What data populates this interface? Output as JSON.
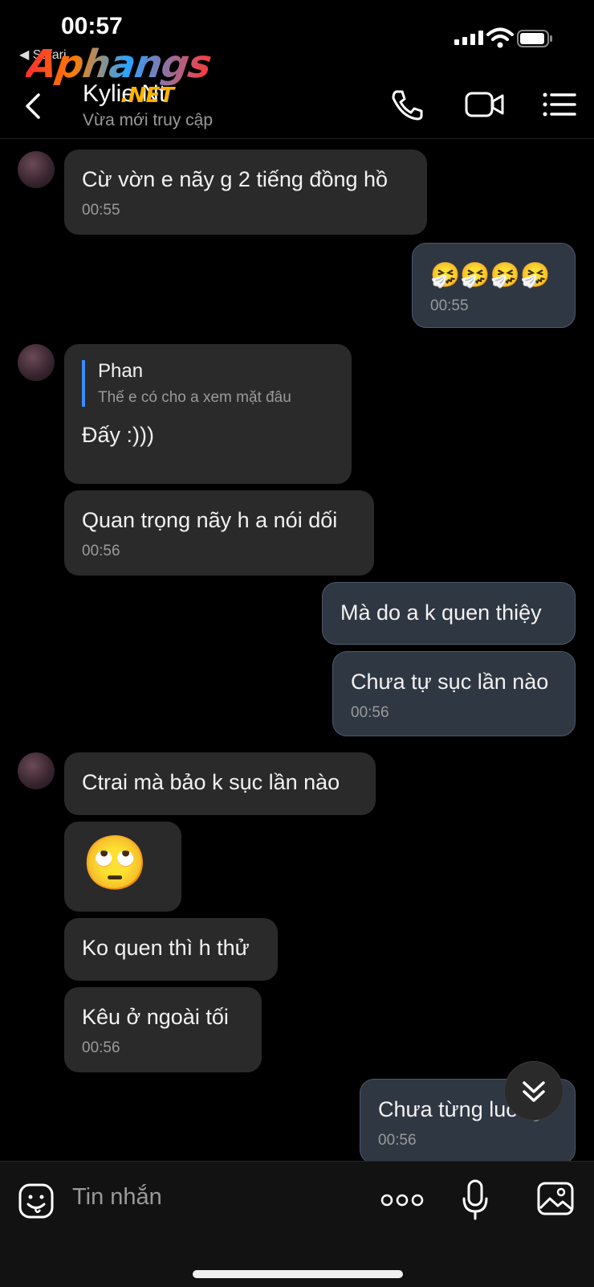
{
  "status_bar": {
    "time": "00:57",
    "back_label": "◀ Safari"
  },
  "watermark": {
    "main": "Aphangs",
    "suffix": ".NET"
  },
  "header": {
    "contact_name": "Kylie Nt",
    "presence": "Vừa mới truy cập"
  },
  "messages": [
    {
      "side": "in",
      "text": "Cừ vờn e nãy g 2 tiếng đồng hồ",
      "time": "00:55"
    },
    {
      "side": "out",
      "text": "🤧🤧🤧🤧",
      "time": "00:55"
    },
    {
      "side": "in",
      "quote_name": "Phan",
      "quote_text": "Thế e có cho a xem mặt đâu",
      "text": "Đấy :)))"
    },
    {
      "side": "in",
      "text": "Quan trọng nãy h a nói dối",
      "time": "00:56"
    },
    {
      "side": "out",
      "text": "Mà do a k quen thiệy"
    },
    {
      "side": "out",
      "text": "Chưa tự sục lần nào",
      "time": "00:56"
    },
    {
      "side": "in",
      "text": "Ctrai mà bảo k sục lần nào"
    },
    {
      "side": "in",
      "text": "🙄"
    },
    {
      "side": "in",
      "text": "Ko quen thì h thử"
    },
    {
      "side": "in",
      "text": "Kêu ở ngoài tối",
      "time": "00:56"
    },
    {
      "side": "out",
      "text": "Chưa từng luông",
      "time": "00:56"
    }
  ],
  "composer": {
    "placeholder": "Tin nhắn"
  },
  "icons": {
    "status": [
      "signal-icon",
      "wifi-icon",
      "battery-icon"
    ],
    "header": [
      "back-icon",
      "phone-icon",
      "video-call-icon",
      "menu-icon"
    ],
    "composer": [
      "sticker-icon",
      "more-icon",
      "microphone-icon",
      "image-icon"
    ]
  },
  "colors": {
    "incoming_bubble": "#2a2a2a",
    "outgoing_bubble": "#2f3742",
    "quote_bar": "#3b8cff"
  }
}
